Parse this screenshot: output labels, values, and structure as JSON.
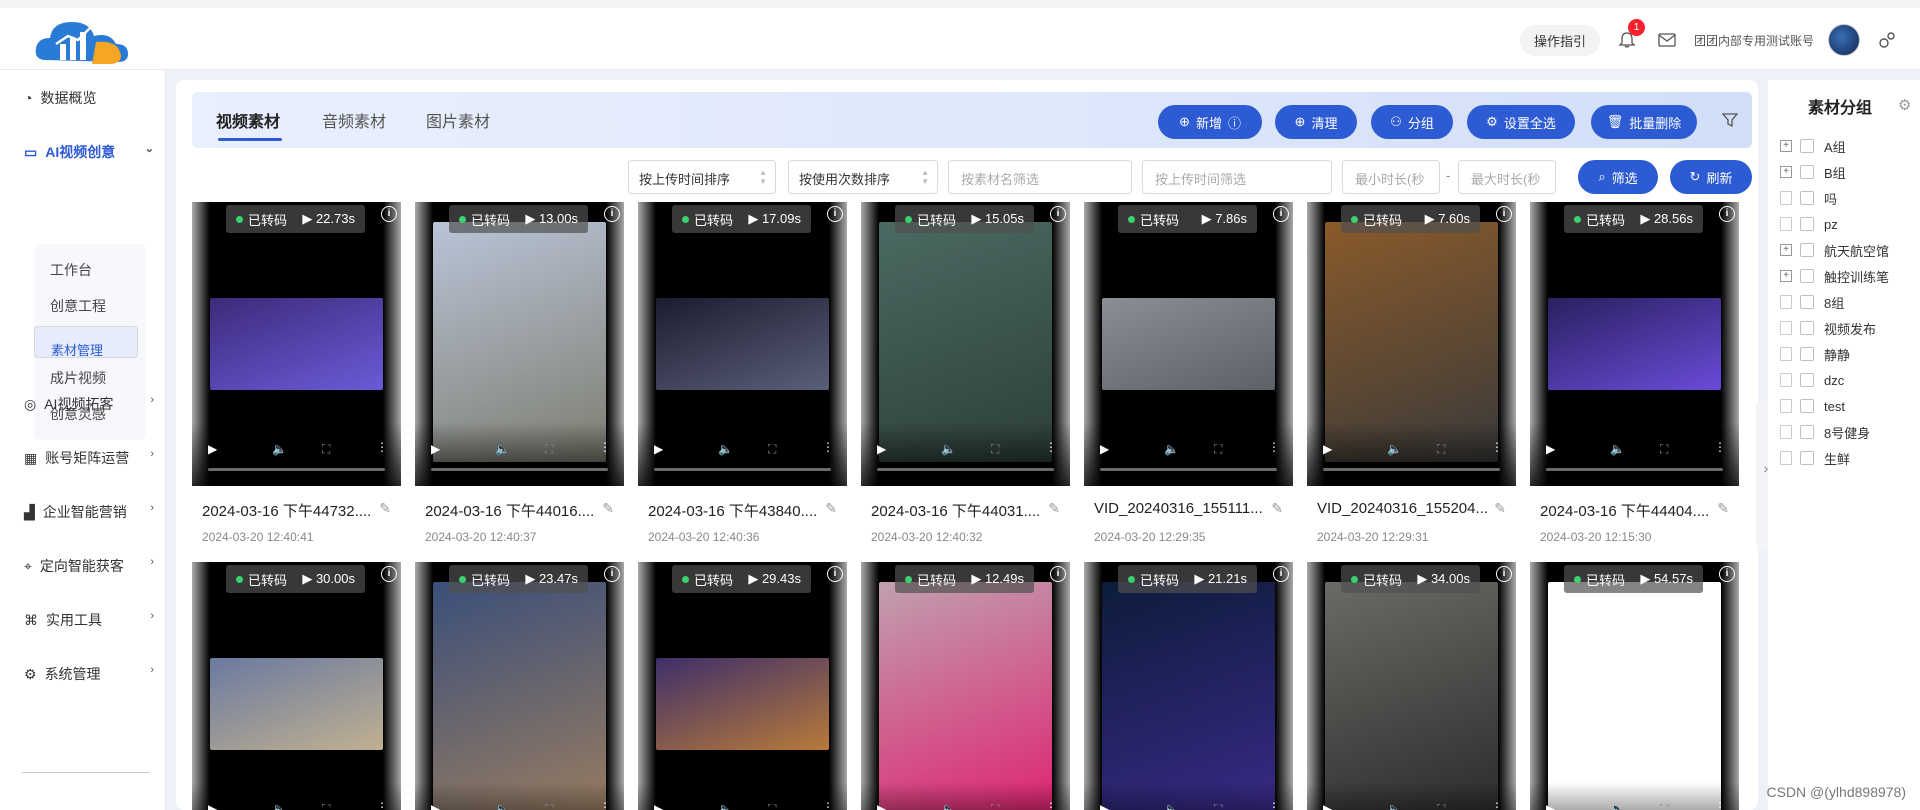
{
  "top_actions": {
    "guide": "操作指引",
    "notification_count": "1",
    "account": "团团内部专用测试账号"
  },
  "sidebar": {
    "items": [
      {
        "label": "数据概览"
      },
      {
        "label": "AI视频创意"
      },
      {
        "label": "AI视频拓客"
      },
      {
        "label": "账号矩阵运营"
      },
      {
        "label": "企业智能营销"
      },
      {
        "label": "定向智能获客"
      },
      {
        "label": "实用工具"
      },
      {
        "label": "系统管理"
      }
    ],
    "sub_items": [
      {
        "label": "工作台"
      },
      {
        "label": "创意工程"
      },
      {
        "label": "素材管理"
      },
      {
        "label": "成片视频"
      },
      {
        "label": "创意灵感"
      }
    ]
  },
  "tabs": [
    "视频素材",
    "音频素材",
    "图片素材"
  ],
  "actions": {
    "add": "新增",
    "clean": "清理",
    "group": "分组",
    "select_all": "设置全选",
    "batch_delete": "批量删除"
  },
  "filters": {
    "sort_upload": "按上传时间排序",
    "sort_usage": "按使用次数排序",
    "name_ph": "按素材名筛选",
    "time_ph": "按上传时间筛选",
    "min_ph": "最小时长(秒",
    "max_ph": "最大时长(秒",
    "dash": "-",
    "filter": "筛选",
    "refresh": "刷新"
  },
  "cards": [
    {
      "status": "已转码",
      "duration": "22.73s",
      "name": "2024-03-16 下午44732....",
      "date": "2024-03-20 12:40:41"
    },
    {
      "status": "已转码",
      "duration": "13.00s",
      "name": "2024-03-16 下午44016....",
      "date": "2024-03-20 12:40:37"
    },
    {
      "status": "已转码",
      "duration": "17.09s",
      "name": "2024-03-16 下午43840....",
      "date": "2024-03-20 12:40:36"
    },
    {
      "status": "已转码",
      "duration": "15.05s",
      "name": "2024-03-16 下午44031....",
      "date": "2024-03-20 12:40:32"
    },
    {
      "status": "已转码",
      "duration": "7.86s",
      "name": "VID_20240316_155111....",
      "date": "2024-03-20 12:29:35"
    },
    {
      "status": "已转码",
      "duration": "7.60s",
      "name": "VID_20240316_155204....",
      "date": "2024-03-20 12:29:31"
    },
    {
      "status": "已转码",
      "duration": "28.56s",
      "name": "2024-03-16 下午44404....",
      "date": "2024-03-20 12:15:30"
    },
    {
      "status": "已转码",
      "duration": "30.00s"
    },
    {
      "status": "已转码",
      "duration": "23.47s"
    },
    {
      "status": "已转码",
      "duration": "29.43s"
    },
    {
      "status": "已转码",
      "duration": "12.49s"
    },
    {
      "status": "已转码",
      "duration": "21.21s"
    },
    {
      "status": "已转码",
      "duration": "34.00s"
    },
    {
      "status": "已转码",
      "duration": "54.57s"
    }
  ],
  "groups": {
    "title": "素材分组",
    "items": [
      {
        "label": "A组",
        "expandable": true
      },
      {
        "label": "B组",
        "expandable": true
      },
      {
        "label": "吗",
        "expandable": false
      },
      {
        "label": "pz",
        "expandable": false
      },
      {
        "label": "航天航空馆",
        "expandable": true
      },
      {
        "label": "触控训练笔",
        "expandable": true
      },
      {
        "label": "8组",
        "expandable": false
      },
      {
        "label": "视频发布",
        "expandable": false
      },
      {
        "label": "静静",
        "expandable": false
      },
      {
        "label": "dzc",
        "expandable": false
      },
      {
        "label": "test",
        "expandable": false
      },
      {
        "label": "8号健身",
        "expandable": false
      },
      {
        "label": "生鲜",
        "expandable": false
      }
    ]
  },
  "watermark": "CSDN @(ylhd898978)",
  "colors": {
    "primary": "#2d5bd3",
    "success": "#3bd16f",
    "badge": "#f5222d"
  }
}
